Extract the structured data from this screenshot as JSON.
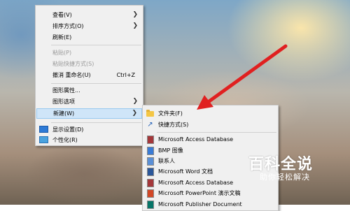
{
  "context_menu": {
    "items": [
      {
        "label": "查看(V)",
        "has_submenu": true
      },
      {
        "label": "排序方式(O)",
        "has_submenu": true
      },
      {
        "label": "刷新(E)"
      },
      {
        "label": "粘贴(P)",
        "disabled": true
      },
      {
        "label": "粘贴快捷方式(S)",
        "disabled": true
      },
      {
        "label": "撤消 重命名(U)",
        "shortcut": "Ctrl+Z"
      },
      {
        "label": "图形属性..."
      },
      {
        "label": "图形选项",
        "has_submenu": true
      },
      {
        "label": "新建(W)",
        "has_submenu": true,
        "highlighted": true
      },
      {
        "label": "显示设置(D)",
        "icon": "display-settings-icon"
      },
      {
        "label": "个性化(R)",
        "icon": "personalize-icon"
      }
    ]
  },
  "new_submenu": {
    "items": [
      {
        "label": "文件夹(F)",
        "icon": "folder-icon"
      },
      {
        "label": "快捷方式(S)",
        "icon": "shortcut-icon"
      },
      {
        "label": "Microsoft Access Database",
        "icon": "access-icon"
      },
      {
        "label": "BMP 图像",
        "icon": "bmp-image-icon"
      },
      {
        "label": "联系人",
        "icon": "contact-icon"
      },
      {
        "label": "Microsoft Word 文档",
        "icon": "word-icon"
      },
      {
        "label": "Microsoft Access Database",
        "icon": "access-icon"
      },
      {
        "label": "Microsoft PowerPoint 演示文稿",
        "icon": "powerpoint-icon"
      },
      {
        "label": "Microsoft Publisher Document",
        "icon": "publisher-icon"
      }
    ]
  },
  "watermark": {
    "title": "百科全说",
    "subtitle": "助你轻松解决"
  },
  "colors": {
    "arrow": "#e02020",
    "menu_bg": "#f0f0f0",
    "highlight": "#cfe5f8"
  }
}
